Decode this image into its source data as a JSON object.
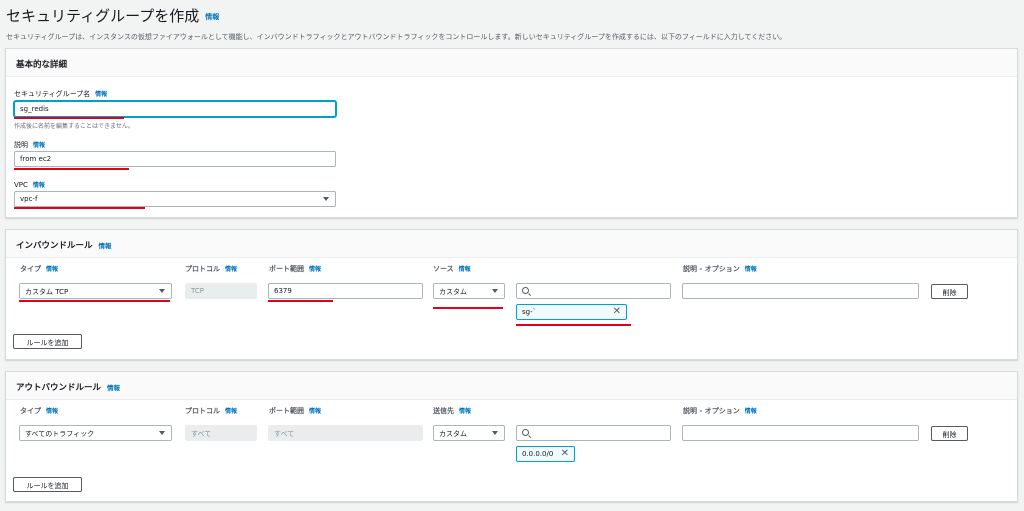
{
  "page": {
    "title": "セキュリティグループを作成",
    "info": "情報",
    "description": "セキュリティグループは、インスタンスの仮想ファイアウォールとして機能し、インバウンドトラフィックとアウトバウンドトラフィックをコントロールします。新しいセキュリティグループを作成するには、以下のフィールドに入力してください。"
  },
  "basic": {
    "heading": "基本的な詳細",
    "name_label": "セキュリティグループ名",
    "name_value": "sg_redis",
    "name_hint": "作成後に名前を編集することはできません。",
    "desc_label": "説明",
    "desc_value": "from ec2",
    "vpc_label": "VPC",
    "vpc_value": "vpc-f"
  },
  "inbound": {
    "heading": "インバウンドルール",
    "columns": {
      "type": "タイプ",
      "protocol": "プロトコル",
      "port": "ポート範囲",
      "source": "ソース",
      "desc": "説明 - オプション"
    },
    "row": {
      "type": "カスタム TCP",
      "protocol": "TCP",
      "port": "6379",
      "source": "カスタム",
      "token": "sg-`",
      "delete": "削除"
    },
    "add": "ルールを追加"
  },
  "outbound": {
    "heading": "アウトバウンドルール",
    "columns": {
      "type": "タイプ",
      "protocol": "プロトコル",
      "port": "ポート範囲",
      "dest": "送信先",
      "desc": "説明 - オプション"
    },
    "row": {
      "type": "すべてのトラフィック",
      "protocol": "すべて",
      "port": "すべて",
      "dest": "カスタム",
      "token": "0.0.0.0/0",
      "delete": "削除"
    },
    "add": "ルールを追加"
  },
  "icons": {
    "search": "search-icon",
    "close": "close-icon",
    "dropdown": "caret-down-icon"
  },
  "colors": {
    "link": "#0073bb",
    "focus": "#00a1c9",
    "annotation": "#e3001b"
  }
}
